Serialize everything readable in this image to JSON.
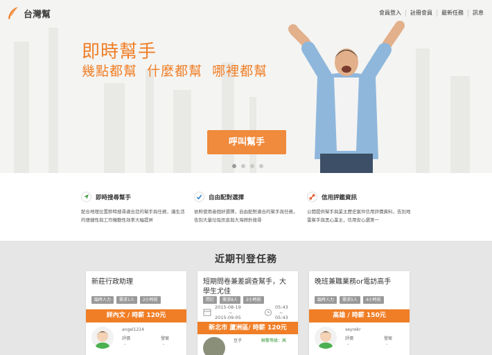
{
  "brand": {
    "name": "台灣幫",
    "color": "#f07e26"
  },
  "nav": {
    "items": [
      "會員登入",
      "註冊會員",
      "最新任務",
      "訊息"
    ]
  },
  "hero": {
    "title": "即時幫手",
    "subtitle": "幾點都幫  什麼都幫  哪裡都幫",
    "cta": "呼叫幫手",
    "slides": 4,
    "active_slide": 1
  },
  "features": [
    {
      "icon": "navigation-arrow-icon",
      "title": "即時搜尋幫手",
      "desc": "配合地理位置即時搜尋適合您的幫手與任務，讓生活的便捷性與工作機動性效率大幅提昇"
    },
    {
      "icon": "checkmark-icon",
      "title": "自由配對選擇",
      "desc": "依照使用者個好選擇，自由配對適合的幫手與任務，告別大量垃圾訊息與大海撈針搜尋"
    },
    {
      "icon": "link-icon",
      "title": "信用評鑑資訊",
      "desc": "公開提供幫手與業主歷史案件信用評價資料，告別地雷幫手與黑心業主，信用安心選第一"
    }
  ],
  "tasks": {
    "heading": "近期刊登任務",
    "cards": [
      {
        "title": "新莊行政助理",
        "tags": [
          "臨時人力",
          "需求1人",
          "2小時前"
        ],
        "pay": "詳內文 / 時薪 120元",
        "user": "angel1214",
        "rating_label": "評價",
        "rating_value": "-",
        "report_label": "發案",
        "report_value": "-"
      },
      {
        "title": "短期問卷兼差調查幫手，大學生尤佳",
        "tags": [
          "問訂",
          "需求8人",
          "2小時前"
        ],
        "date_from": "2015-08-19",
        "date_to": "2015-09-05",
        "time_from": "05:43",
        "time_to": "05:43",
        "date_sep": "~",
        "pay": "新北市 蘆洲區/ 時薪 120元",
        "user": "豆子",
        "status": "聯繫等級：高"
      },
      {
        "title": "晚班兼職業務or電訪高手",
        "tags": [
          "臨時人力",
          "需求5人",
          "4小時前"
        ],
        "pay": "高雄 / 時薪 150元",
        "user": "xeyrekr",
        "rating_label": "評價",
        "rating_value": "-",
        "report_label": "發案",
        "report_value": "-"
      }
    ]
  }
}
